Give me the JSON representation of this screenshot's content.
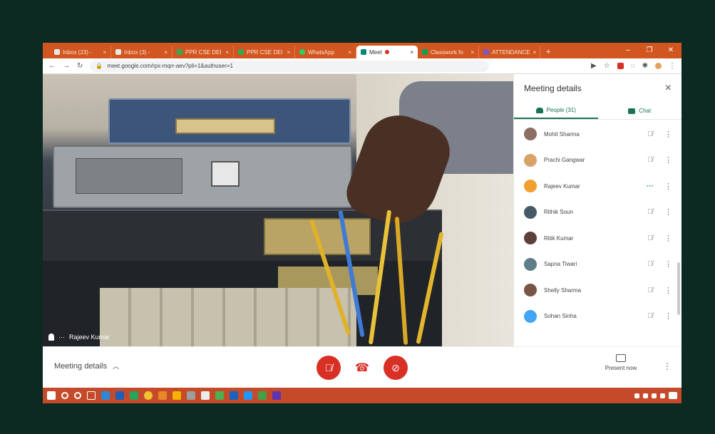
{
  "browser": {
    "tabs": [
      {
        "label": "Inbox (23) -",
        "color": "#e8e8e8",
        "active": false
      },
      {
        "label": "Inbox (3) -",
        "color": "#e8e8e8",
        "active": false
      },
      {
        "label": "PPR CSE DEI",
        "color": "#34a853",
        "active": false
      },
      {
        "label": "PPR CSE DEI",
        "color": "#34a853",
        "active": false
      },
      {
        "label": "WhatsApp",
        "color": "#25d366",
        "active": false
      },
      {
        "label": "Meet",
        "color": "#00897b",
        "active": true
      },
      {
        "label": "Classwork fo",
        "color": "#0f9d58",
        "active": false
      },
      {
        "label": "ATTENDANCE",
        "color": "#7e57c2",
        "active": false
      }
    ],
    "new_tab": "+",
    "url": "meet.google.com/rpx-mqrr-aev?pli=1&authuser=1"
  },
  "video": {
    "speaker_name": "Rajeev Kumar"
  },
  "panel": {
    "title": "Meeting details",
    "close": "×",
    "people_tab": "People (31)",
    "chat_tab": "Chat",
    "participants": [
      {
        "name": "Mohit Sharma",
        "avatar": "#8d6e63",
        "mic": "muted"
      },
      {
        "name": "Prachi Gangwar",
        "avatar": "#d7a36b",
        "mic": "muted"
      },
      {
        "name": "Rajeev Kumar",
        "avatar": "#f0a030",
        "mic": "active"
      },
      {
        "name": "Rithik Soun",
        "avatar": "#455a64",
        "mic": "muted"
      },
      {
        "name": "Ritik Kumar",
        "avatar": "#5d4037",
        "mic": "muted"
      },
      {
        "name": "Sapna Tiwari",
        "avatar": "#607d8b",
        "mic": "muted"
      },
      {
        "name": "Shelly Sharma",
        "avatar": "#795548",
        "mic": "muted"
      },
      {
        "name": "Sohan Sinha",
        "avatar": "#42a5f5",
        "mic": "muted"
      }
    ]
  },
  "bottom": {
    "meeting_details": "Meeting details",
    "present_now": "Present now"
  },
  "colors": {
    "accent": "#1a7350",
    "end_call": "#d93025",
    "tabbar": "#d2561f",
    "taskbar": "#c54a2a"
  }
}
